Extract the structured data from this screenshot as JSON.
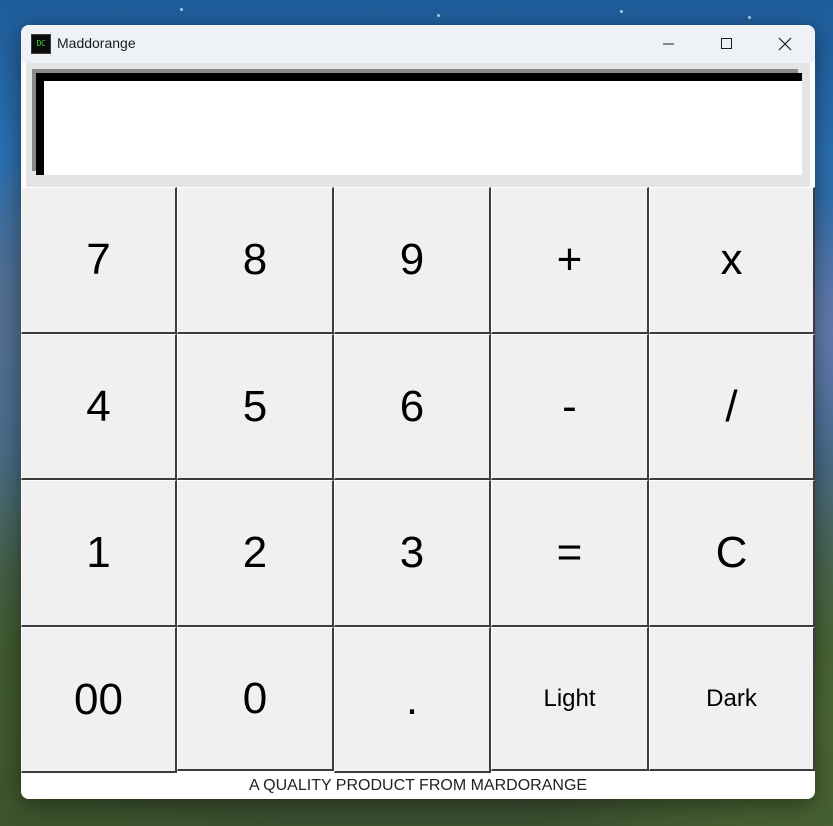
{
  "window": {
    "title": "Maddorange",
    "icon_text": "DC",
    "icon": "dc-app-icon",
    "controls": {
      "minimize": "minimize-icon",
      "maximize": "maximize-icon",
      "close": "close-icon"
    }
  },
  "display": {
    "value": ""
  },
  "keys": {
    "row1": [
      "7",
      "8",
      "9",
      "+",
      "x"
    ],
    "row2": [
      "4",
      "5",
      "6",
      "-",
      "/"
    ],
    "row3": [
      "1",
      "2",
      "3",
      "=",
      "C"
    ],
    "row4": [
      "00",
      "0",
      ".",
      "Light",
      "Dark"
    ]
  },
  "footer": {
    "text": "A QUALITY PRODUCT FROM MARDORANGE"
  },
  "colors": {
    "key_background": "#f0f0f0",
    "display_background": "#ffffff",
    "display_border": "#000000",
    "titlebar": "#eef2f7"
  }
}
